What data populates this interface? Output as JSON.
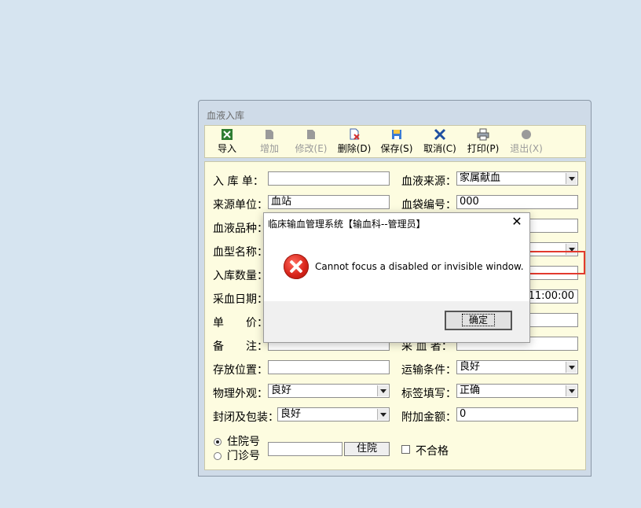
{
  "window": {
    "title": "血液入库"
  },
  "toolbar": {
    "import": "导入",
    "add": "增加",
    "edit": "修改(E)",
    "delete": "删除(D)",
    "save": "保存(S)",
    "cancel": "取消(C)",
    "print": "打印(P)",
    "exit": "退出(X)"
  },
  "form": {
    "receipt_label": "入 库 单：",
    "receipt_value": "",
    "blood_source_label": "血液来源：",
    "blood_source_value": "家属献血",
    "source_unit_label": "来源单位：",
    "source_unit_value": "血站",
    "bag_no_label": "血袋编号：",
    "bag_no_value": "000",
    "blood_kind_label": "血液品种：",
    "blood_type_label": "血型名称：",
    "quantity_label": "入库数量：",
    "collect_date_label": "采血日期：",
    "collect_time_value": "11:00:00",
    "price_label": "单　　价：",
    "remark_label": "备　　注：",
    "collector_label": "采 血 者：",
    "storage_label": "存放位置：",
    "storage_value": "",
    "transport_label": "运输条件：",
    "transport_value": "良好",
    "appearance_label": "物理外观：",
    "appearance_value": "良好",
    "label_fill_label": "标签填写：",
    "label_fill_value": "正确",
    "seal_label": "封闭及包装：",
    "seal_value": "良好",
    "extra_fee_label": "附加金额：",
    "extra_fee_value": "0",
    "radio_inpatient": "住院号",
    "radio_outpatient": "门诊号",
    "patient_button": "住院",
    "unqualified_label": "不合格"
  },
  "dialog": {
    "title": "临床输血管理系统【输血科--管理员】",
    "close": "✕",
    "message": "Cannot focus a disabled or invisible window.",
    "ok": "确定"
  },
  "colors": {
    "highlight": "#e23a2e",
    "panel_bg": "#fdfce0",
    "desktop_bg": "#d6e4f0"
  }
}
